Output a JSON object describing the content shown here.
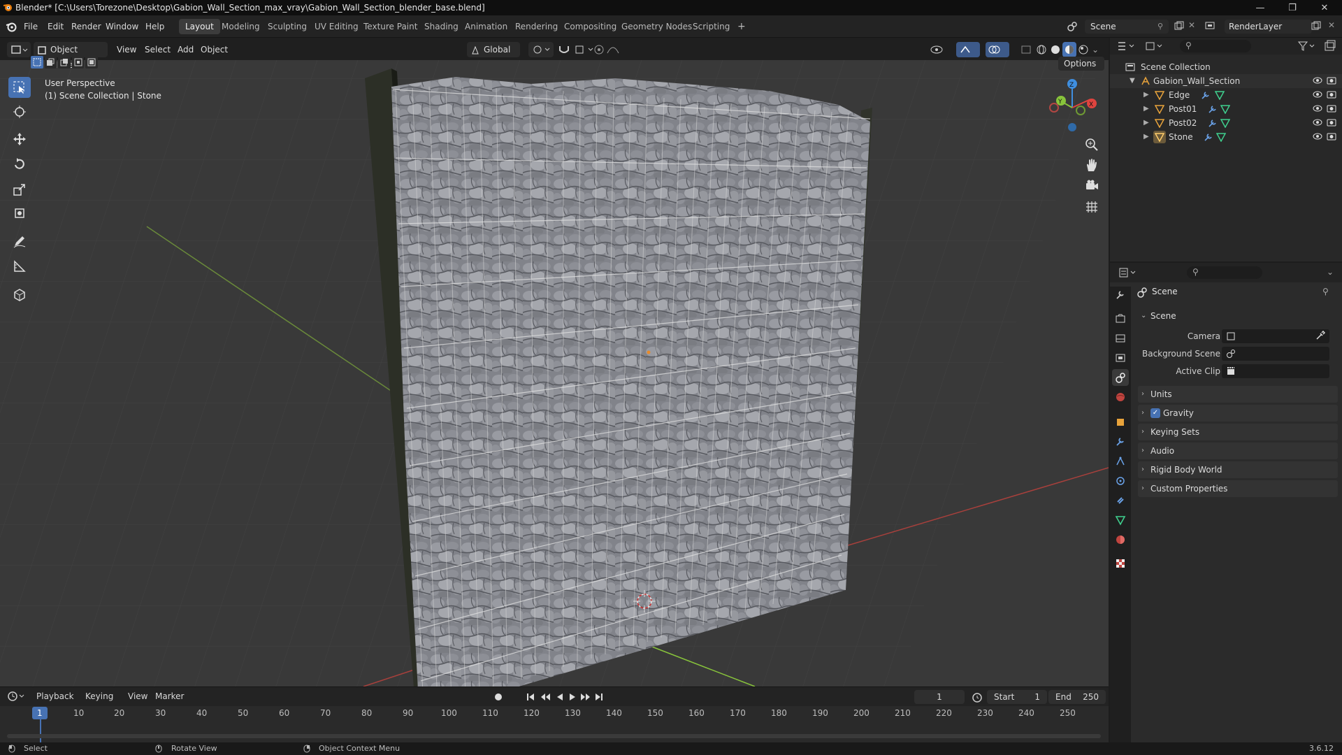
{
  "window": {
    "title": "Blender* [C:\\Users\\Torezone\\Desktop\\Gabion_Wall_Section_max_vray\\Gabion_Wall_Section_blender_base.blend]",
    "minimize": "—",
    "maximize": "❐",
    "close": "✕"
  },
  "menu": [
    "File",
    "Edit",
    "Render",
    "Window",
    "Help"
  ],
  "workspaces": [
    "Layout",
    "Modeling",
    "Sculpting",
    "UV Editing",
    "Texture Paint",
    "Shading",
    "Animation",
    "Rendering",
    "Compositing",
    "Geometry Nodes",
    "Scripting"
  ],
  "workspace_add": "+",
  "scene_name": "Scene",
  "render_layer": "RenderLayer",
  "viewport_header": {
    "mode": "Object Mode",
    "menus": [
      "View",
      "Select",
      "Add",
      "Object"
    ],
    "transform_orientation": "Global",
    "options": "Options"
  },
  "viewport_overlay": {
    "perspective": "User Perspective",
    "collection_info": "(1) Scene Collection | Stone"
  },
  "gizmo": {
    "z": "Z",
    "y": "Y",
    "x": "X"
  },
  "outliner": {
    "root": "Scene Collection",
    "collection": "Gabion_Wall_Section",
    "objects": [
      "Edge",
      "Post01",
      "Post02",
      "Stone"
    ]
  },
  "properties": {
    "context": "Scene",
    "panel_scene": "Scene",
    "camera_label": "Camera",
    "background_scene_label": "Background Scene",
    "active_clip_label": "Active Clip",
    "panels": [
      "Units",
      "Gravity",
      "Keying Sets",
      "Audio",
      "Rigid Body World",
      "Custom Properties"
    ],
    "gravity_enabled": true
  },
  "timeline": {
    "menus": [
      "Playback",
      "Keying",
      "View",
      "Marker"
    ],
    "current_frame": "1",
    "start_label": "Start",
    "start": "1",
    "end_label": "End",
    "end": "250",
    "ticks": [
      "1",
      "10",
      "20",
      "30",
      "40",
      "50",
      "60",
      "70",
      "80",
      "90",
      "100",
      "110",
      "120",
      "130",
      "140",
      "150",
      "160",
      "170",
      "180",
      "190",
      "200",
      "210",
      "220",
      "230",
      "240",
      "250"
    ]
  },
  "statusbar": {
    "select": "Select",
    "rotate_view": "Rotate View",
    "context_menu": "Object Context Menu",
    "version": "3.6.12"
  },
  "colors": {
    "accent": "#4772b3",
    "axis_x": "#e0443f",
    "axis_y": "#88c43b",
    "axis_z": "#3f8fe0",
    "frame_marker": "#4772b3"
  }
}
